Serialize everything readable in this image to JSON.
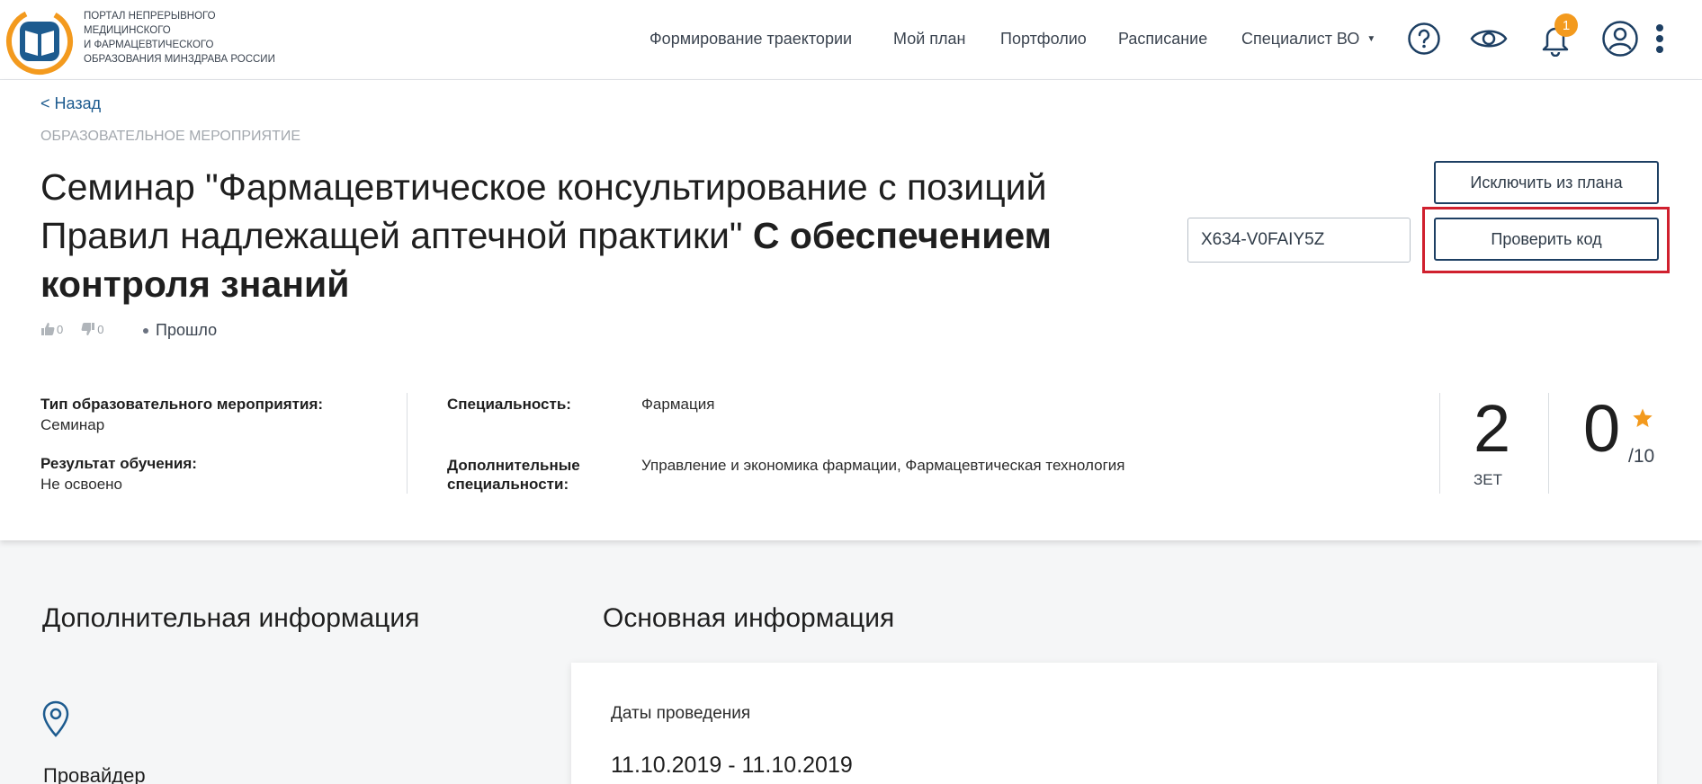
{
  "header": {
    "logo_text": [
      "ПОРТАЛ НЕПРЕРЫВНОГО",
      "МЕДИЦИНСКОГО",
      "И ФАРМАЦЕВТИЧЕСКОГО",
      "ОБРАЗОВАНИЯ МИНЗДРАВА РОССИИ"
    ],
    "nav": [
      "Формирование траектории",
      "Мой план",
      "Портфолио",
      "Расписание",
      "Специалист ВО"
    ],
    "notifications_count": "1",
    "brand_color": "#1d5b8f",
    "accent_color": "#f39a1e",
    "icons": [
      "help-icon",
      "eye-icon",
      "bell-icon",
      "user-icon",
      "more-vertical-icon"
    ]
  },
  "event": {
    "back_label": "< Назад",
    "kicker": "ОБРАЗОВАТЕЛЬНОЕ МЕРОПРИЯТИЕ",
    "title_regular_line1": "Семинар \"Фармацевтическое консультирование с позиций",
    "title_regular_line2": "Правил надлежащей аптечной практики\"",
    "title_bold_line2": "С обеспечением",
    "title_bold_line3": "контроля знаний",
    "exclude_button": "Исключить из плана",
    "code_value": "X634-V0FAIY5Z",
    "check_button": "Проверить код",
    "likes": "0",
    "dislikes": "0",
    "status": "Прошло",
    "highlight_color": "#d0202e"
  },
  "details": {
    "type_label": "Тип образовательного мероприятия:",
    "type_value": "Семинар",
    "result_label": "Результат обучения:",
    "result_value": "Не освоено",
    "specialty_label": "Специальность:",
    "specialty_value": "Фармация",
    "extra_label_1": "Дополнительные",
    "extra_label_2": "специальности:",
    "extra_value": "Управление и экономика фармации, Фармацевтическая технология",
    "zet_value": "2",
    "zet_label": "ЗЕТ",
    "rating_value": "0",
    "rating_max": "/10"
  },
  "lower": {
    "additional_info_title": "Дополнительная информация",
    "main_info_title": "Основная информация",
    "dates_label": "Даты проведения",
    "dates_value": "11.10.2019 - 11.10.2019",
    "provider_label": "Провайдер"
  }
}
